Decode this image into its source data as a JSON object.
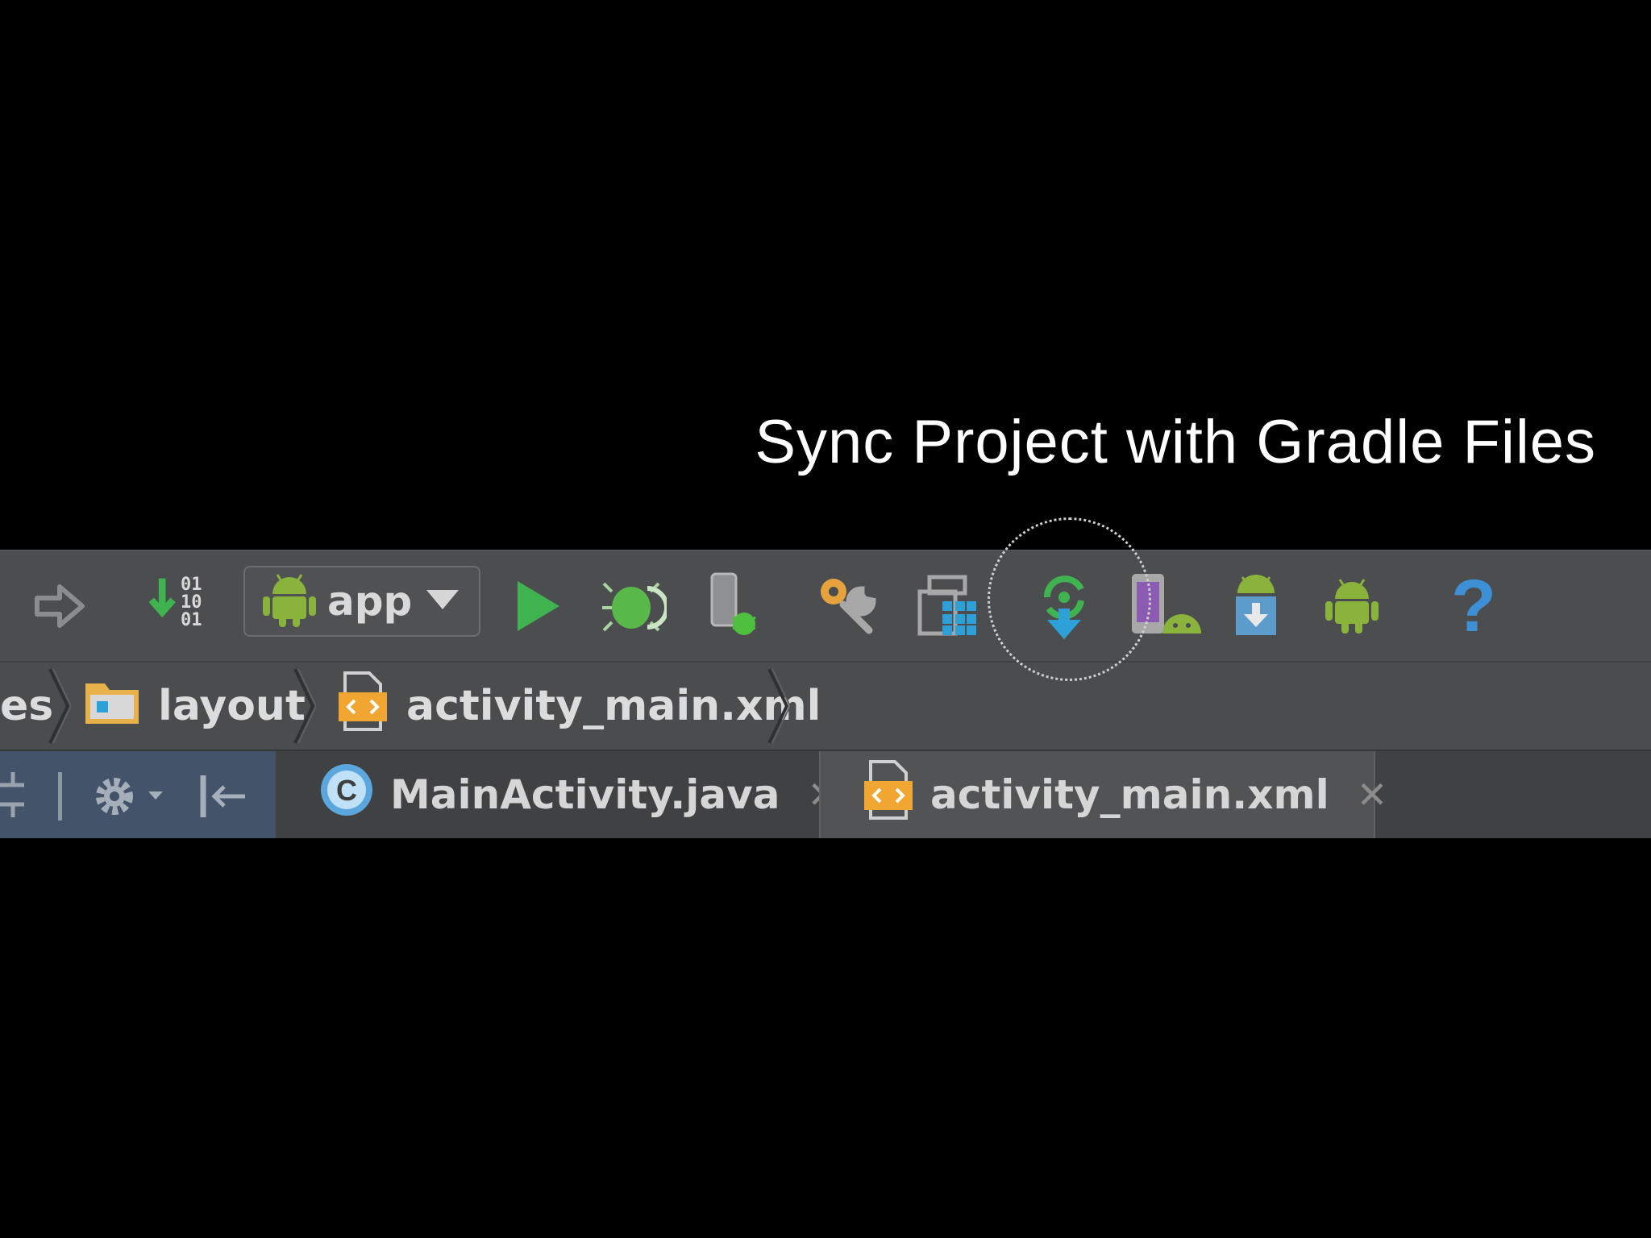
{
  "caption": "Sync Project with Gradle Files",
  "toolbar": {
    "run_config_label": "app",
    "make_icon_digits": [
      "01",
      "10",
      "01"
    ],
    "help_glyph": "?",
    "items": [
      {
        "icon": "forward-arrow-icon"
      },
      {
        "icon": "make-project-icon"
      },
      {
        "icon": "run-icon",
        "color": "#3fb34f"
      },
      {
        "icon": "debug-icon",
        "color": "#59b84a"
      },
      {
        "icon": "attach-debugger-icon"
      },
      {
        "icon": "project-structure-icon"
      },
      {
        "icon": "avd-layout-icon"
      },
      {
        "icon": "gradle-sync-icon",
        "color": "#2ea0d8"
      },
      {
        "icon": "avd-manager-icon"
      },
      {
        "icon": "sdk-manager-icon"
      },
      {
        "icon": "android-monitor-icon",
        "color": "#8ab33b"
      },
      {
        "icon": "help-icon",
        "color": "#3d8fd6"
      }
    ]
  },
  "breadcrumb": {
    "items": [
      "es",
      "layout",
      "activity_main.xml"
    ]
  },
  "tabs": [
    {
      "label": "MainActivity.java",
      "icon": "java-class-icon",
      "active": false
    },
    {
      "label": "activity_main.xml",
      "icon": "xml-file-icon",
      "active": true
    }
  ],
  "colors": {
    "background": "#000000",
    "toolbar": "#4b4d4f",
    "android_green": "#8ab33b",
    "accent_blue": "#2ea0d8",
    "xml_orange": "#f0a630"
  }
}
